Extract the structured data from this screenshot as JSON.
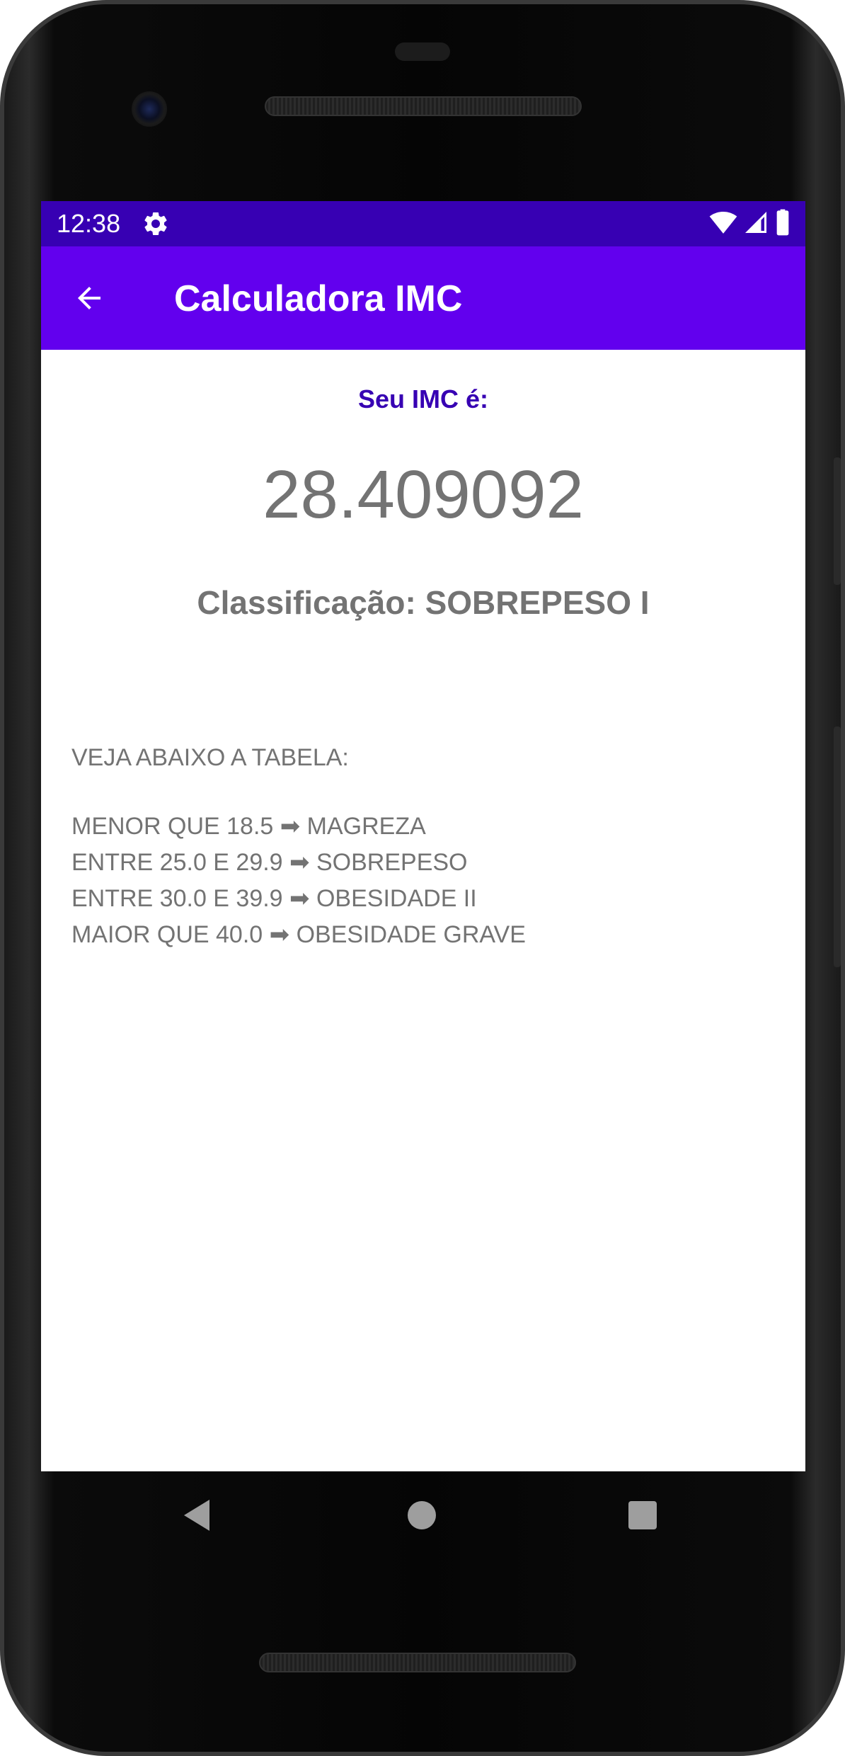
{
  "status_bar": {
    "time": "12:38",
    "icons": [
      "gear-icon",
      "wifi-icon",
      "signal-icon",
      "battery-icon"
    ],
    "background": "#3700b3"
  },
  "app_bar": {
    "title": "Calculadora IMC",
    "background": "#6200ee"
  },
  "result": {
    "label": "Seu IMC é:",
    "value": "28.409092",
    "classification": "Classificação: SOBREPESO I",
    "label_color": "#3700b3",
    "text_color": "#737373"
  },
  "table": {
    "heading": "VEJA ABAIXO A TABELA:",
    "rows": [
      "MENOR QUE 18.5 ➡ MAGREZA",
      "ENTRE 25.0 E 29.9 ➡ SOBREPESO",
      "ENTRE 30.0 E 39.9 ➡ OBESIDADE II",
      "MAIOR QUE 40.0 ➡ OBESIDADE GRAVE"
    ]
  },
  "nav_bar": {
    "buttons": [
      "back-triangle-icon",
      "home-circle-icon",
      "recents-square-icon"
    ]
  }
}
